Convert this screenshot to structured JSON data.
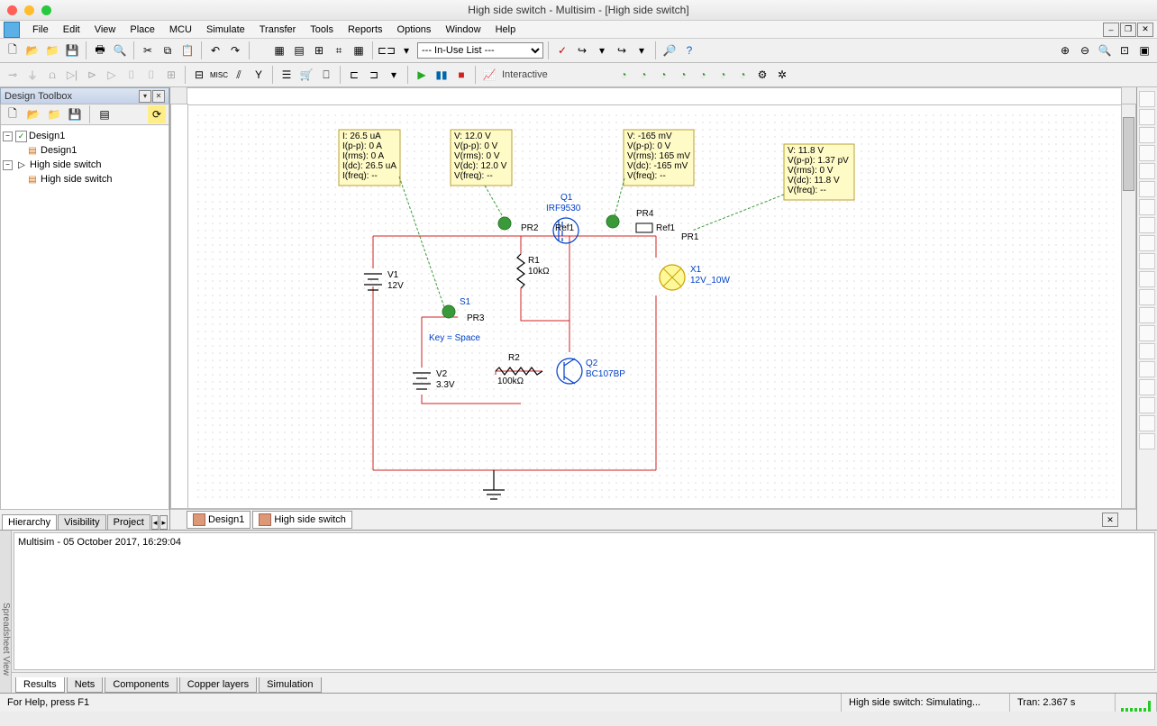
{
  "title": "High side switch - Multisim - [High side switch]",
  "menu": {
    "file": "File",
    "edit": "Edit",
    "view": "View",
    "place": "Place",
    "mcu": "MCU",
    "simulate": "Simulate",
    "transfer": "Transfer",
    "tools": "Tools",
    "reports": "Reports",
    "options": "Options",
    "window": "Window",
    "help": "Help"
  },
  "toolbar1": {
    "combo": "--- In-Use List ---",
    "interactive": "Interactive"
  },
  "sidebar": {
    "title": "Design Toolbox",
    "tree": {
      "root1": {
        "label": "Design1",
        "child": "Design1"
      },
      "root2": {
        "label": "High side switch",
        "child": "High side switch"
      }
    },
    "tabs": {
      "hierarchy": "Hierarchy",
      "visibility": "Visibility",
      "project": "Project"
    }
  },
  "notes": {
    "pr3": {
      "l1": "I: 26.5 uA",
      "l2": "I(p-p): 0 A",
      "l3": "I(rms): 0 A",
      "l4": "I(dc): 26.5 uA",
      "l5": "I(freq): --"
    },
    "pr2": {
      "l1": "V: 12.0 V",
      "l2": "V(p-p): 0 V",
      "l3": "V(rms): 0 V",
      "l4": "V(dc): 12.0 V",
      "l5": "V(freq): --"
    },
    "pr4": {
      "l1": "V: -165 mV",
      "l2": "V(p-p): 0 V",
      "l3": "V(rms): 165 mV",
      "l4": "V(dc): -165 mV",
      "l5": "V(freq): --"
    },
    "pr1": {
      "l1": "V: 11.8 V",
      "l2": "V(p-p): 1.37 pV",
      "l3": "V(rms): 0 V",
      "l4": "V(dc): 11.8 V",
      "l5": "V(freq): --"
    }
  },
  "components": {
    "v1": {
      "ref": "V1",
      "val": "12V"
    },
    "v2": {
      "ref": "V2",
      "val": "3.3V"
    },
    "r1": {
      "ref": "R1",
      "val": "10kΩ"
    },
    "r2": {
      "ref": "R2",
      "val": "100kΩ"
    },
    "q1": {
      "ref": "Q1",
      "val": "IRF9530"
    },
    "q2": {
      "ref": "Q2",
      "val": "BC107BP"
    },
    "x1": {
      "ref": "X1",
      "val": "12V_10W"
    },
    "s1": {
      "ref": "S1",
      "key": "Key = Space"
    },
    "pr1": "PR1",
    "pr2": "PR2",
    "pr3": "PR3",
    "pr4": "PR4",
    "ref1": "Ref1",
    "ref1b": "Ref1"
  },
  "doc_tabs": {
    "t1": "Design1",
    "t2": "High side switch"
  },
  "log": {
    "handle": "Spreadsheet View",
    "text": "Multisim  -  05 October 2017, 16:29:04",
    "tabs": {
      "results": "Results",
      "nets": "Nets",
      "components": "Components",
      "copper": "Copper layers",
      "simulation": "Simulation"
    }
  },
  "status": {
    "help": "For Help, press F1",
    "sim": "High side switch: Simulating...",
    "tran": "Tran: 2.367 s"
  }
}
